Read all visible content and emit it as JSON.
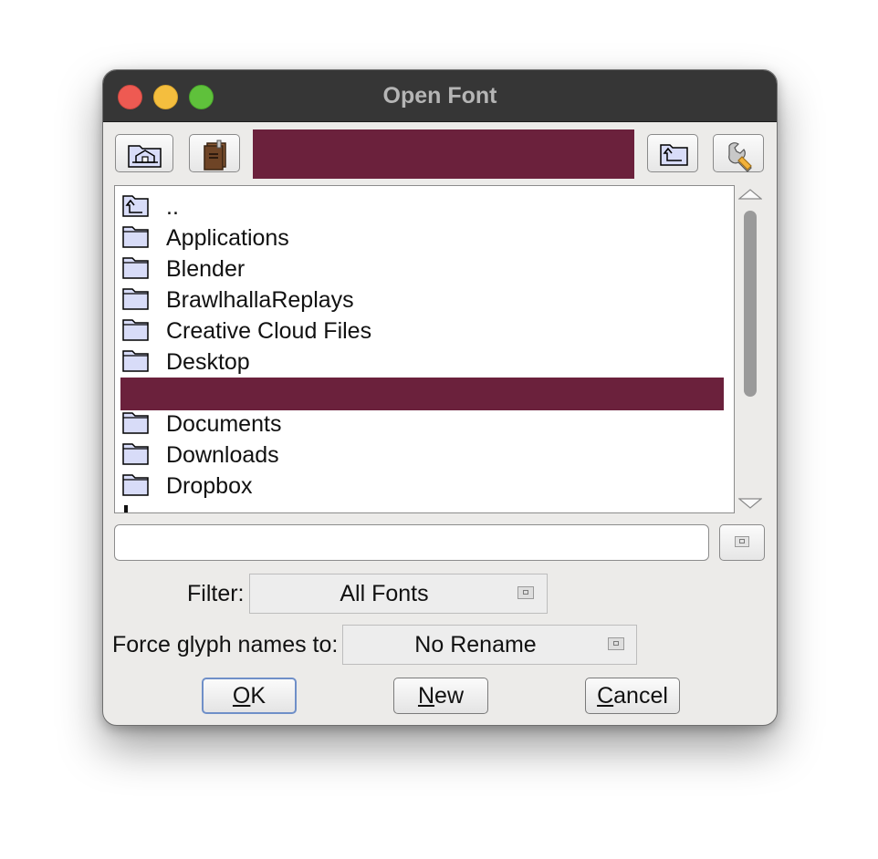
{
  "window": {
    "title": "Open Font"
  },
  "toolbar": {
    "home_tooltip": "Home",
    "bookmarks_tooltip": "Bookmarks",
    "path_value": "",
    "parent_tooltip": "Parent directory",
    "tools_tooltip": "Settings"
  },
  "file_list": {
    "items": [
      {
        "label": "..",
        "icon": "parent-dir-icon"
      },
      {
        "label": "Applications",
        "icon": "folder-icon"
      },
      {
        "label": "Blender",
        "icon": "folder-icon"
      },
      {
        "label": "BrawlhallaReplays",
        "icon": "folder-icon"
      },
      {
        "label": "Creative Cloud Files",
        "icon": "folder-icon"
      },
      {
        "label": "Desktop",
        "icon": "folder-icon"
      },
      {
        "label": "",
        "icon": "folder-icon",
        "selected": true
      },
      {
        "label": "Documents",
        "icon": "folder-icon"
      },
      {
        "label": "Downloads",
        "icon": "folder-icon"
      },
      {
        "label": "Dropbox",
        "icon": "folder-icon"
      }
    ]
  },
  "filename": {
    "value": ""
  },
  "filter": {
    "label": "Filter:",
    "selected": "All Fonts"
  },
  "glyph_names": {
    "label": "Force glyph names to:",
    "selected": "No Rename"
  },
  "actions": {
    "ok_mnemonic": "O",
    "ok_rest": "K",
    "new_mnemonic": "N",
    "new_rest": "ew",
    "cancel_mnemonic": "C",
    "cancel_rest": "ancel"
  },
  "colors": {
    "selection": "#6b213c",
    "titlebar": "#363636",
    "folder_fill": "#d8dcf8"
  }
}
